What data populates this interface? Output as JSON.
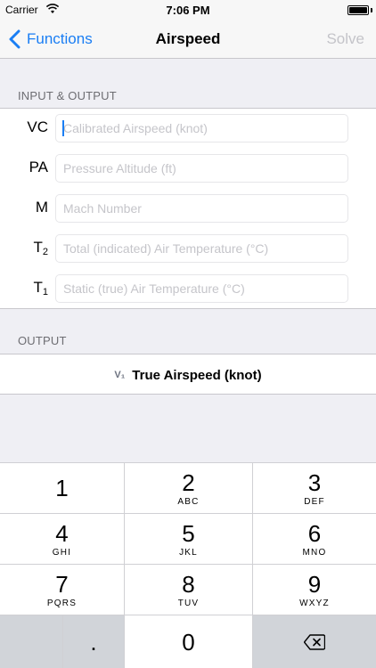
{
  "status_bar": {
    "carrier": "Carrier",
    "wifi_icon": "wifi-icon",
    "time": "7:06 PM",
    "battery_icon": "battery-full-icon"
  },
  "nav": {
    "back_label": "Functions",
    "back_icon": "chevron-left-icon",
    "title": "Airspeed",
    "solve_label": "Solve",
    "accent_color": "#1a7ef4",
    "disabled_color": "#c4c4c9"
  },
  "input_section": {
    "header": "INPUT & OUTPUT",
    "rows": [
      {
        "symbol": "VC",
        "sub": "",
        "placeholder": "Calibrated Airspeed (knot)",
        "value": ""
      },
      {
        "symbol": "PA",
        "sub": "",
        "placeholder": "Pressure Altitude (ft)",
        "value": ""
      },
      {
        "symbol": "M",
        "sub": "",
        "placeholder": "Mach Number",
        "value": ""
      },
      {
        "symbol": "T",
        "sub": "2",
        "placeholder": "Total (indicated) Air Temperature (°C)",
        "value": ""
      },
      {
        "symbol": "T",
        "sub": "1",
        "placeholder": "Static (true) Air Temperature (°C)",
        "value": ""
      }
    ]
  },
  "output_section": {
    "header": "OUTPUT",
    "symbol": "V₁",
    "label": "True Airspeed (knot)"
  },
  "keypad": {
    "keys": [
      {
        "digit": "1",
        "letters": ""
      },
      {
        "digit": "2",
        "letters": "ABC"
      },
      {
        "digit": "3",
        "letters": "DEF"
      },
      {
        "digit": "4",
        "letters": "GHI"
      },
      {
        "digit": "5",
        "letters": "JKL"
      },
      {
        "digit": "6",
        "letters": "MNO"
      },
      {
        "digit": "7",
        "letters": "PQRS"
      },
      {
        "digit": "8",
        "letters": "TUV"
      },
      {
        "digit": "9",
        "letters": "WXYZ"
      }
    ],
    "decimal": ".",
    "zero": "0",
    "delete_icon": "backspace-icon"
  }
}
